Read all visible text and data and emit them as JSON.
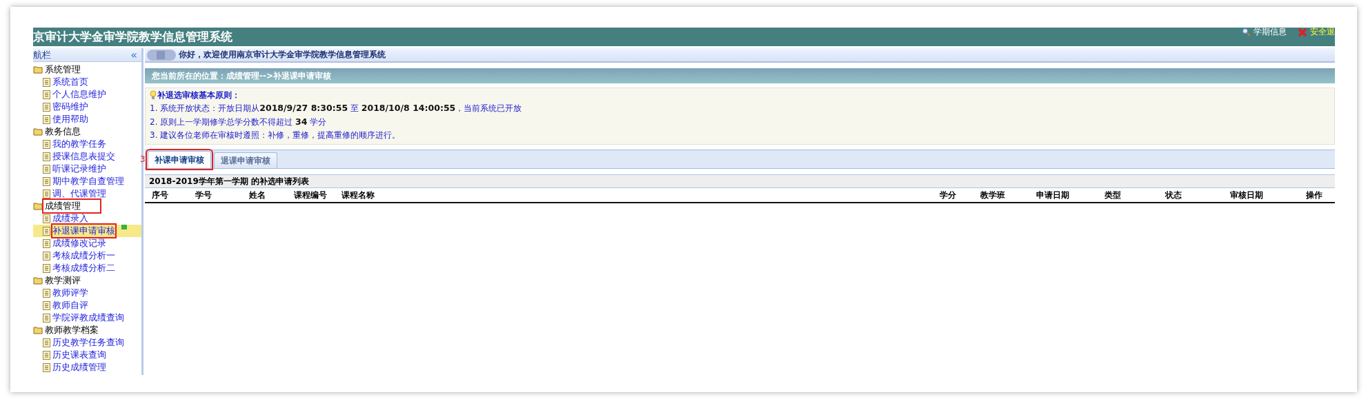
{
  "header": {
    "title": "京审计大学金审学院教学信息管理系统",
    "links": [
      {
        "kind": "term",
        "label": "学期信息"
      },
      {
        "kind": "logout",
        "label": "安全退"
      }
    ]
  },
  "sidebar": {
    "title": "航栏",
    "collapse": "«",
    "groups": [
      {
        "label": "系统管理",
        "highlighted": false,
        "items": [
          {
            "label": "系统首页",
            "selected": false,
            "highlighted": false
          },
          {
            "label": "个人信息维护",
            "selected": false,
            "highlighted": false
          },
          {
            "label": "密码维护",
            "selected": false,
            "highlighted": false
          },
          {
            "label": "使用帮助",
            "selected": false,
            "highlighted": false
          }
        ]
      },
      {
        "label": "教务信息",
        "highlighted": false,
        "items": [
          {
            "label": "我的教学任务",
            "selected": false,
            "highlighted": false
          },
          {
            "label": "授课信息表提交",
            "selected": false,
            "highlighted": false
          },
          {
            "label": "听课记录维护",
            "selected": false,
            "highlighted": false
          },
          {
            "label": "期中教学自查管理",
            "selected": false,
            "highlighted": false
          },
          {
            "label": "调、代课管理",
            "selected": false,
            "highlighted": false
          }
        ]
      },
      {
        "label": "成绩管理",
        "highlighted": true,
        "items": [
          {
            "label": "成绩录入",
            "selected": false,
            "highlighted": false
          },
          {
            "label": "补退课申请审核",
            "selected": true,
            "highlighted": true
          },
          {
            "label": "成绩修改记录",
            "selected": false,
            "highlighted": false
          },
          {
            "label": "考核成绩分析一",
            "selected": false,
            "highlighted": false
          },
          {
            "label": "考核成绩分析二",
            "selected": false,
            "highlighted": false
          }
        ]
      },
      {
        "label": "教学测评",
        "highlighted": false,
        "items": [
          {
            "label": "教师评学",
            "selected": false,
            "highlighted": false
          },
          {
            "label": "教师自评",
            "selected": false,
            "highlighted": false
          },
          {
            "label": "学院评教成绩查询",
            "selected": false,
            "highlighted": false
          }
        ]
      },
      {
        "label": "教师教学档案",
        "highlighted": false,
        "items": [
          {
            "label": "历史教学任务查询",
            "selected": false,
            "highlighted": false
          },
          {
            "label": "历史课表查询",
            "selected": false,
            "highlighted": false
          },
          {
            "label": "历史成绩管理",
            "selected": false,
            "highlighted": false
          }
        ]
      }
    ]
  },
  "welcome": "你好，欢迎使用南京审计大学金审学院教学信息管理系统",
  "location": "您当前所在的位置：成绩管理-->补退课申请审核",
  "notice": {
    "title": "补退选审核基本原则：",
    "lines": [
      "1. 系统开放状态：开放日期从**2018/9/27 8:30:55** 至 **2018/10/8 14:00:55**，当前系统已开放",
      "2. 原则上一学期修学总学分数不得超过 **34** 学分",
      "3. 建议各位老师在审核时遵照：补修，重修，提高重修的顺序进行。"
    ]
  },
  "annotation_number": "3",
  "tabs": [
    {
      "label": "补课申请审核",
      "selected": true,
      "highlighted": true
    },
    {
      "label": "退课申请审核",
      "selected": false,
      "highlighted": false
    }
  ],
  "table": {
    "title": "2018-2019学年第一学期 的补选申请列表",
    "columns": [
      "序号",
      "学号",
      "姓名",
      "课程编号",
      "课程名称",
      "学分",
      "教学班",
      "申请日期",
      "类型",
      "状态",
      "审核日期",
      "操作"
    ]
  }
}
